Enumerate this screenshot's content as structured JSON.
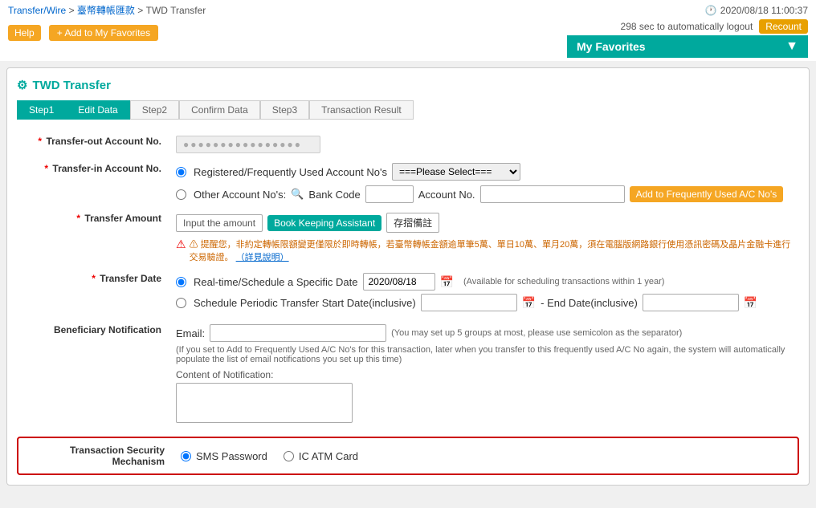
{
  "breadcrumb": {
    "items": [
      "Transfer/Wire",
      "臺幣轉帳匯款",
      "TWD Transfer"
    ]
  },
  "header": {
    "help_label": "Help",
    "add_favorites_label": "+ Add to My Favorites",
    "datetime": "2020/08/18 11:00:37",
    "logout_text": "298 sec to automatically logout",
    "recount_label": "Recount",
    "my_favorites_label": "My Favorites"
  },
  "page_title": "TWD Transfer",
  "steps": [
    {
      "label": "Step1"
    },
    {
      "label": "Edit Data"
    },
    {
      "label": "Step2"
    },
    {
      "label": "Confirm Data"
    },
    {
      "label": "Step3"
    },
    {
      "label": "Transaction Result"
    }
  ],
  "form": {
    "transfer_out_label": "Transfer-out Account No.",
    "transfer_out_value": "●●●●●●●●●●●●●●●●",
    "transfer_in_label": "Transfer-in Account No.",
    "registered_option": "Registered/Frequently Used Account No's",
    "registered_placeholder": "===Please Select===",
    "other_option": "Other Account No's:",
    "bank_code_label": "Bank Code",
    "account_no_label": "Account No.",
    "add_fav_ac_label": "Add to Frequently Used A/C No's",
    "transfer_amount_label": "Transfer Amount",
    "input_amount_label": "Input the amount",
    "bookkeeping_label": "Book Keeping Assistant",
    "memo_label": "存摺備註",
    "warning_text": "⚠ 提醒您，非約定轉帳限額變更僅限於即時轉帳，若臺幣轉帳金額逾單筆5萬、單日10萬、單月20萬，須在電腦版網路銀行使用憑訊密碼及晶片金融卡進行交易驗證。",
    "warning_link": "（詳見說明）",
    "transfer_date_label": "Transfer Date",
    "realtime_option": "Real-time/Schedule a Specific Date",
    "date_value": "2020/08/18",
    "date_note": "(Available for scheduling transactions within 1 year)",
    "schedule_option": "Schedule Periodic Transfer Start Date(inclusive)",
    "end_date_label": "- End Date(inclusive)",
    "beneficiary_label": "Beneficiary Notification",
    "email_label": "Email:",
    "email_note": "(You may set up 5 groups at most, please use semicolon as the separator)",
    "beneficiary_note": "(If you set to Add to Frequently Used A/C No's for this transaction, later when you transfer to this frequently used A/C No again, the system will automatically populate the list of email notifications you set up this time)",
    "content_label": "Content of Notification:",
    "security_label": "Transaction Security Mechanism",
    "sms_option": "SMS Password",
    "ic_atm_option": "IC ATM Card"
  }
}
